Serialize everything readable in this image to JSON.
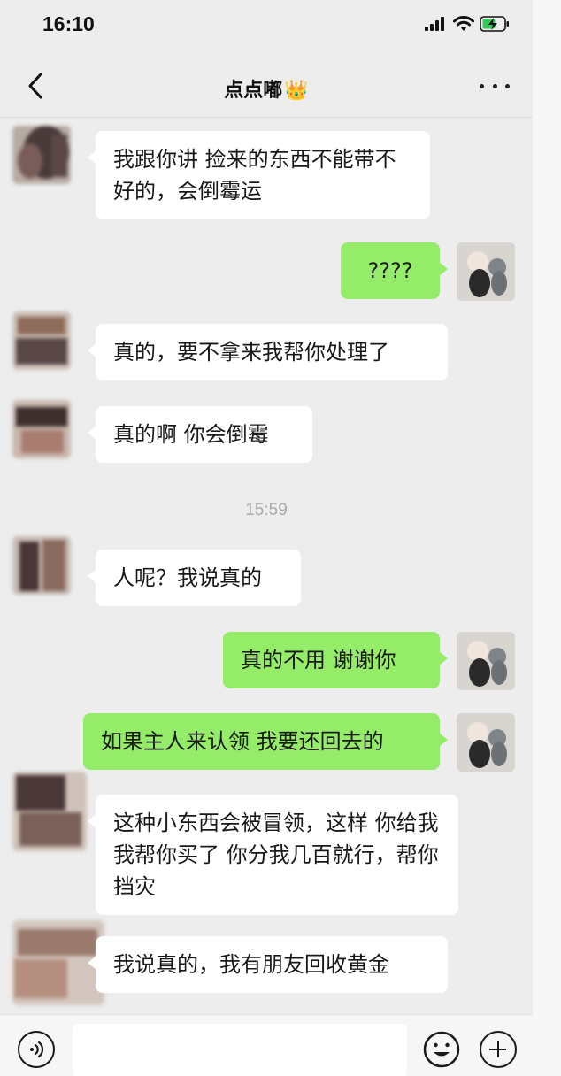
{
  "status_bar": {
    "time": "16:10"
  },
  "nav": {
    "title": "点点嘟",
    "title_emoji": "👑"
  },
  "messages": [
    {
      "side": "in",
      "text": "我跟你讲 捡来的东西不能带不好的，会倒霉运"
    },
    {
      "side": "out",
      "text": "????"
    },
    {
      "side": "in",
      "text": "真的，要不拿来我帮你处理了"
    },
    {
      "side": "in",
      "text": "真的啊  你会倒霉"
    },
    {
      "side": "in",
      "text": "人呢？我说真的"
    },
    {
      "side": "out",
      "text": "真的不用  谢谢你"
    },
    {
      "side": "out",
      "text": "如果主人来认领 我要还回去的"
    },
    {
      "side": "in",
      "text": "这种小东西会被冒领，这样 你给我我帮你买了  你分我几百就行，帮你挡灾"
    },
    {
      "side": "in",
      "text": "我说真的，我有朋友回收黄金"
    }
  ],
  "timestamp": "15:59",
  "input_bar": {
    "placeholder": ""
  },
  "colors": {
    "background": "#ededed",
    "bubble_out": "#95ec69",
    "bubble_in": "#ffffff"
  }
}
